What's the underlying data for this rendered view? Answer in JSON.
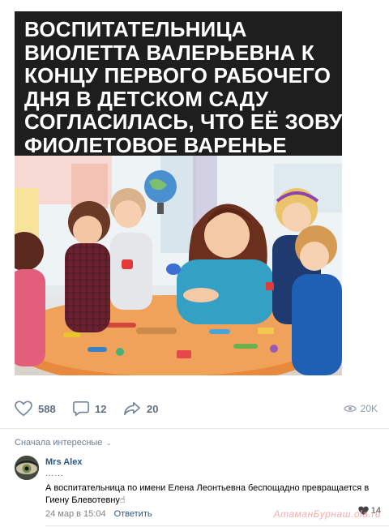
{
  "post": {
    "headline_lines": [
      "ВОСПИТАТЕЛЬНИЦА",
      "ВИОЛЕТТА ВАЛЕРЬЕВНА К",
      "КОНЦУ ПЕРВОГО РАБОЧЕГО",
      "ДНЯ В ДЕТСКОМ САДУ",
      "СОГЛАСИЛАСЬ, ЧТО ЕЁ ЗОВУТ",
      "ФИОЛЕТОВОЕ ВАРЕНЬЕ"
    ],
    "likes": "588",
    "comments": "12",
    "shares": "20",
    "views": "20K"
  },
  "comments_section": {
    "sort_label": "Сначала интересные",
    "comment": {
      "author": "Mrs Alex",
      "dots": "......",
      "text": "А воспитательница по имени Елена Леонтьевна беспощадно превращается в Гиену Блевотевну☝",
      "date": "24 мар в 15:04",
      "reply_label": "Ответить",
      "likes": "14"
    }
  },
  "watermark": "АтаманБурнаш.ola.ru",
  "colors": {
    "headline_bg": "#1e1e1e",
    "link": "#2a5885",
    "icon": "#5d6b7a",
    "divider": "#e7e8ec"
  }
}
